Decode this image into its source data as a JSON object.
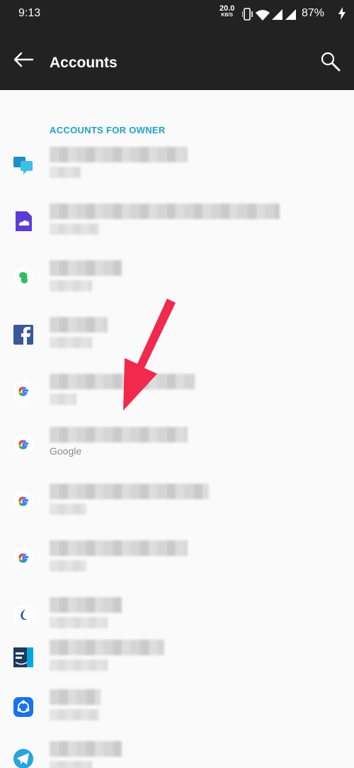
{
  "status_bar": {
    "time": "9:13",
    "net_speed": "20.0",
    "net_unit": "KB/S",
    "battery": "87%"
  },
  "app_bar": {
    "title": "Accounts"
  },
  "section_header": "ACCOUNTS FOR OWNER",
  "accounts": [
    {
      "icon": "chat-app-icon",
      "label": ""
    },
    {
      "icon": "cloud-file-icon",
      "label": ""
    },
    {
      "icon": "evernote-icon",
      "label": ""
    },
    {
      "icon": "facebook-icon",
      "label": ""
    },
    {
      "icon": "google-icon",
      "label": ""
    },
    {
      "icon": "google-icon",
      "label": "Google"
    },
    {
      "icon": "google-icon",
      "label": ""
    },
    {
      "icon": "google-icon",
      "label": ""
    },
    {
      "icon": "bird-app-icon",
      "label": ""
    },
    {
      "icon": "prime-video-icon",
      "label": ""
    },
    {
      "icon": "shareit-icon",
      "label": ""
    },
    {
      "icon": "telegram-icon",
      "label": ""
    }
  ],
  "colors": {
    "bar": "#222222",
    "accent": "#1fa1c9",
    "arrow": "#f0294d",
    "background": "#fafafa"
  }
}
